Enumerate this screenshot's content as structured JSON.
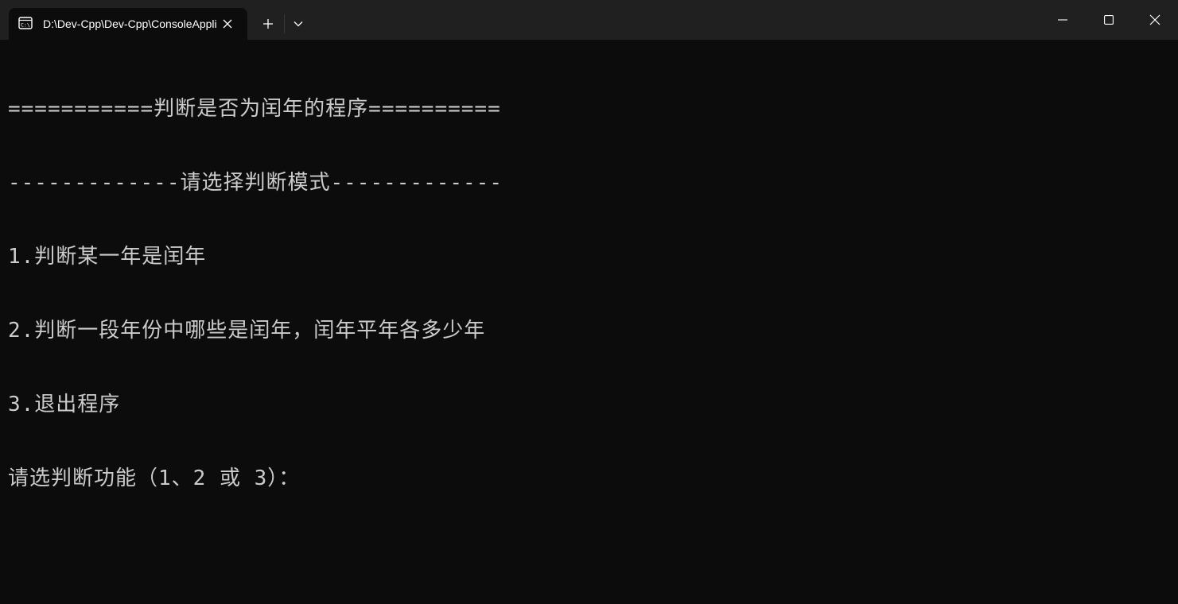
{
  "tab": {
    "title": "D:\\Dev-Cpp\\Dev-Cpp\\ConsoleApplication.exe"
  },
  "icons": {
    "tab_icon": "terminal-icon",
    "close": "close-icon",
    "new_tab": "plus-icon",
    "dropdown": "chevron-down-icon",
    "minimize": "minimize-icon",
    "maximize": "maximize-icon",
    "window_close": "window-close-icon"
  },
  "console": {
    "lines": [
      "===========判断是否为闰年的程序==========",
      "-------------请选择判断模式-------------",
      "1.判断某一年是闰年",
      "2.判断一段年份中哪些是闰年，闰年平年各多少年",
      "3.退出程序",
      "请选判断功能（1、2 或 3）："
    ]
  },
  "colors": {
    "background": "#0c0c0c",
    "titlebar": "#202020",
    "text": "#cccccc"
  }
}
